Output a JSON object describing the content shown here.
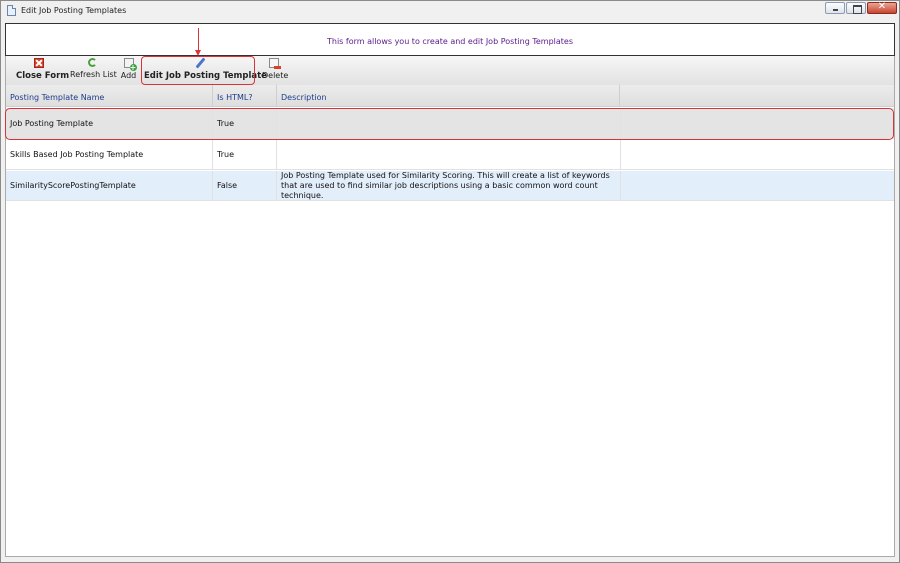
{
  "window": {
    "title": "Edit Job Posting Templates",
    "icon": "document-icon",
    "close_glyph": "✕"
  },
  "banner": {
    "text": "This form allows you to create and edit Job Posting Templates",
    "color": "#5a1a8c"
  },
  "toolbar": {
    "close_form": "Close Form",
    "refresh_list": "Refresh List",
    "add": "Add",
    "edit": "Edit Job Posting Template",
    "delete": "Delete"
  },
  "grid": {
    "columns": [
      "Posting Template Name",
      "Is HTML?",
      "Description"
    ],
    "rows": [
      {
        "name": "Job Posting Template",
        "is_html": "True",
        "description": ""
      },
      {
        "name": "Skills Based Job Posting Template",
        "is_html": "True",
        "description": ""
      },
      {
        "name": "SimilarityScorePostingTemplate",
        "is_html": "False",
        "description": "Job Posting Template used for Similarity Scoring. This will create a list of keywords that are used to find similar job descriptions using a basic common word count technique."
      }
    ]
  },
  "colors": {
    "header_text": "#1f3c8a",
    "highlight": "#d9333a",
    "selected_row": "#e4e4e4",
    "alt_row": "#e3eefb"
  }
}
